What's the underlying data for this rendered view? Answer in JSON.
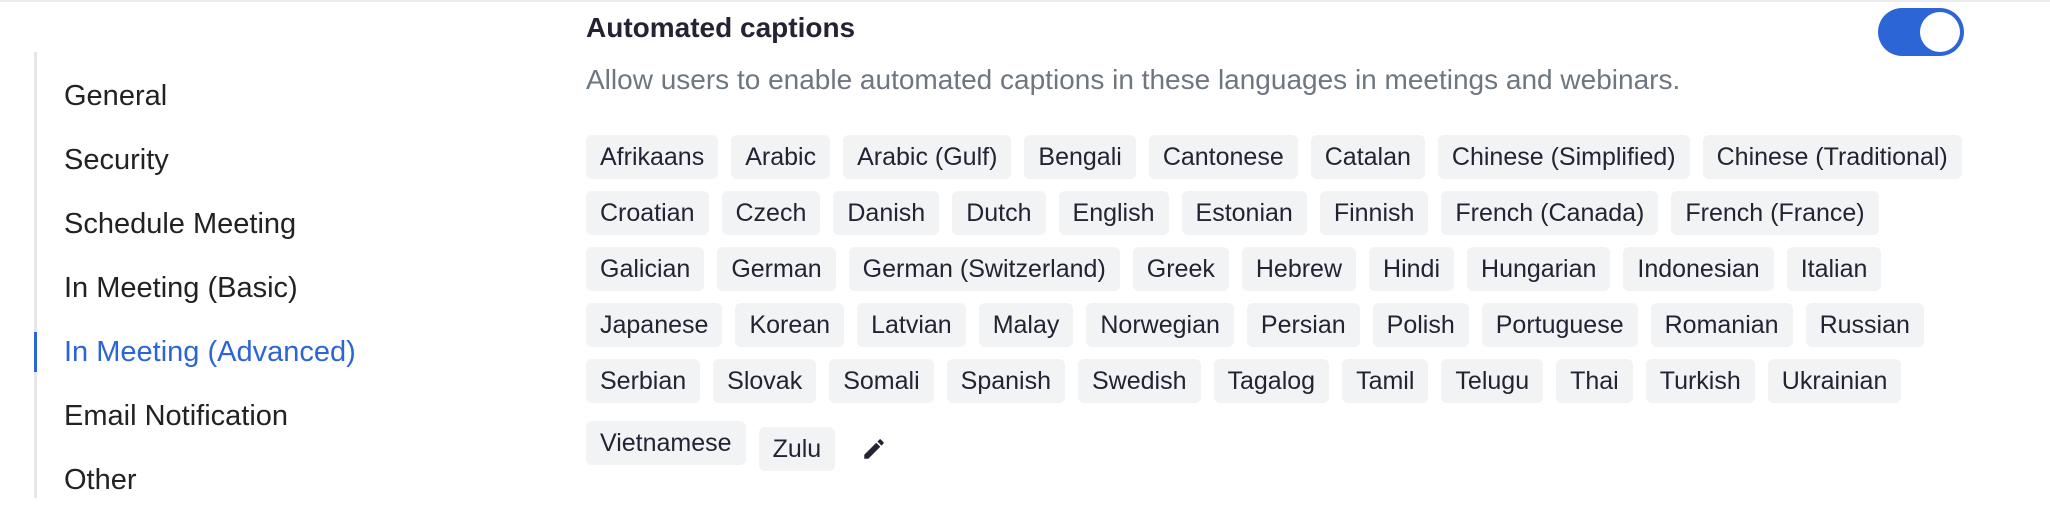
{
  "sidebar": {
    "items": [
      {
        "label": "General"
      },
      {
        "label": "Security"
      },
      {
        "label": "Schedule Meeting"
      },
      {
        "label": "In Meeting (Basic)"
      },
      {
        "label": "In Meeting (Advanced)",
        "active": true
      },
      {
        "label": "Email Notification"
      },
      {
        "label": "Other"
      }
    ]
  },
  "setting": {
    "title": "Automated captions",
    "description": "Allow users to enable automated captions in these languages in meetings and webinars.",
    "enabled": true,
    "languages": [
      "Afrikaans",
      "Arabic",
      "Arabic (Gulf)",
      "Bengali",
      "Cantonese",
      "Catalan",
      "Chinese (Simplified)",
      "Chinese (Traditional)",
      "Croatian",
      "Czech",
      "Danish",
      "Dutch",
      "English",
      "Estonian",
      "Finnish",
      "French (Canada)",
      "French (France)",
      "Galician",
      "German",
      "German (Switzerland)",
      "Greek",
      "Hebrew",
      "Hindi",
      "Hungarian",
      "Indonesian",
      "Italian",
      "Japanese",
      "Korean",
      "Latvian",
      "Malay",
      "Norwegian",
      "Persian",
      "Polish",
      "Portuguese",
      "Romanian",
      "Russian",
      "Serbian",
      "Slovak",
      "Somali",
      "Spanish",
      "Swedish",
      "Tagalog",
      "Tamil",
      "Telugu",
      "Thai",
      "Turkish",
      "Ukrainian",
      "Vietnamese",
      "Zulu"
    ],
    "edit_icon": "pencil-icon"
  },
  "colors": {
    "accent": "#2c65d6",
    "tag_bg": "#f2f3f5",
    "muted_text": "#6e7680"
  }
}
